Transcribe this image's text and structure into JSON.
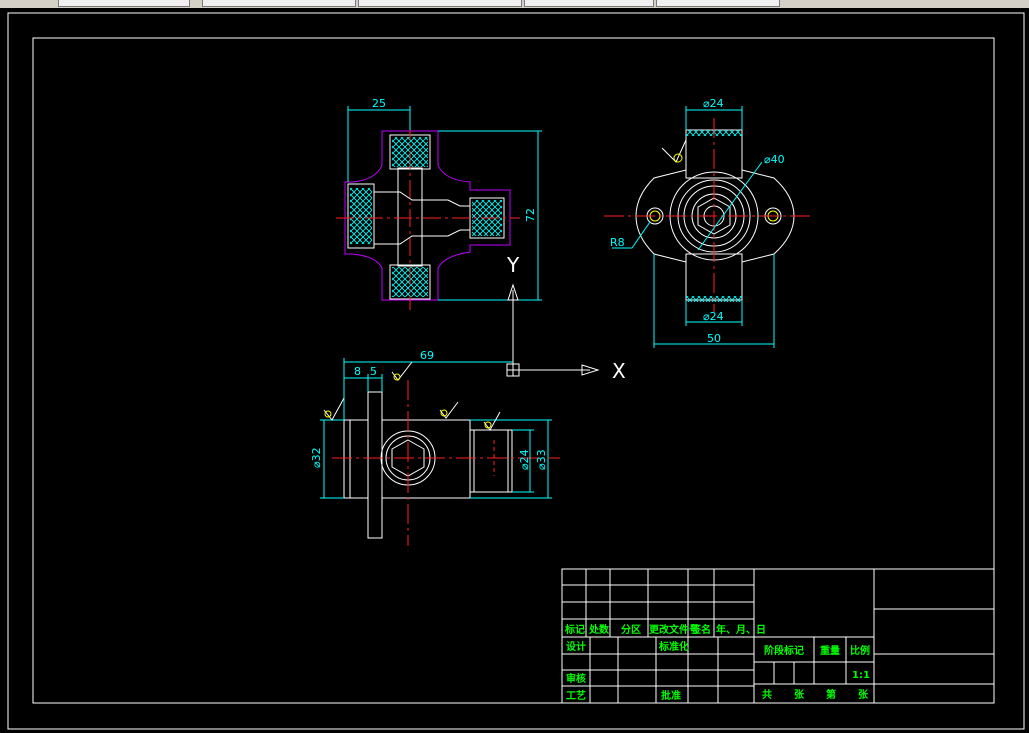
{
  "colors": {
    "background": "#000000",
    "geometry": "#ffffff",
    "dimension": "#00ffff",
    "centerline": "#ff2020",
    "hatch": "#c000ff",
    "titleblock_text": "#00ff00"
  },
  "axes": {
    "x_label": "X",
    "y_label": "Y"
  },
  "dimensions": {
    "top_width": "25",
    "top_height": "72",
    "right_top_dia": "⌀24",
    "right_boss_dia": "⌀40",
    "right_radius": "R8",
    "right_bottom_dia": "⌀24",
    "right_width": "50",
    "front_length": "69",
    "front_step1": "8",
    "front_step2": "5",
    "front_left_dia": "⌀32",
    "front_right_dia1": "⌀24",
    "front_right_dia2": "⌀33"
  },
  "title_block": {
    "mark": "标记",
    "count": "处数",
    "zone": "分区",
    "change_doc": "更改文件号",
    "signature": "签名",
    "date": "年、月、日",
    "design": "设计",
    "standardize": "标准化",
    "review": "审核",
    "process": "工艺",
    "approve": "批准",
    "stage_mark": "阶段标记",
    "weight": "重量",
    "scale": "比例",
    "scale_value": "1:1",
    "total": "共",
    "sheets": "张",
    "page": "第",
    "sheet": "张"
  }
}
